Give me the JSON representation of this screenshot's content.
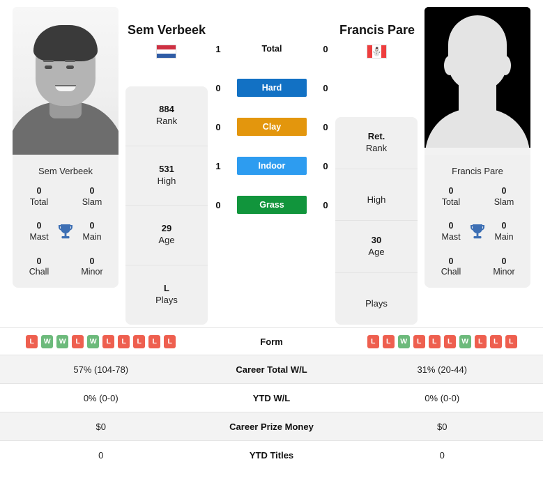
{
  "colors": {
    "hard": "#1271c4",
    "clay": "#e3960d",
    "indoor": "#2d9cf0",
    "grass": "#11953c",
    "win": "#6cba7b",
    "loss": "#ee5f4f",
    "panel": "#f0f0f0",
    "trophy": "#3d6fb4"
  },
  "players": {
    "left": {
      "name": "Sem Verbeek",
      "card_name": "Sem Verbeek",
      "country": "Netherlands",
      "flag_icon": "flag-netherlands-icon",
      "photo_icon": "player-photo",
      "titles": [
        {
          "value": "0",
          "label": "Total"
        },
        {
          "value": "0",
          "label": "Slam"
        },
        {
          "value": "0",
          "label": "Mast"
        },
        {
          "value": "0",
          "label": "Main"
        },
        {
          "value": "0",
          "label": "Chall"
        },
        {
          "value": "0",
          "label": "Minor"
        }
      ],
      "meta": [
        {
          "value": "884",
          "label": "Rank"
        },
        {
          "value": "531",
          "label": "High"
        },
        {
          "value": "29",
          "label": "Age"
        },
        {
          "value": "L",
          "label": "Plays"
        }
      ],
      "form": [
        "L",
        "W",
        "W",
        "L",
        "W",
        "L",
        "L",
        "L",
        "L",
        "L"
      ]
    },
    "right": {
      "name": "Francis Pare",
      "card_name": "Francis Pare",
      "country": "Canada",
      "flag_icon": "flag-canada-icon",
      "photo_icon": "player-silhouette-placeholder",
      "titles": [
        {
          "value": "0",
          "label": "Total"
        },
        {
          "value": "0",
          "label": "Slam"
        },
        {
          "value": "0",
          "label": "Mast"
        },
        {
          "value": "0",
          "label": "Main"
        },
        {
          "value": "0",
          "label": "Chall"
        },
        {
          "value": "0",
          "label": "Minor"
        }
      ],
      "meta": [
        {
          "value": "Ret.",
          "label": "Rank"
        },
        {
          "value": "",
          "label": "High"
        },
        {
          "value": "30",
          "label": "Age"
        },
        {
          "value": "",
          "label": "Plays"
        }
      ],
      "form": [
        "L",
        "L",
        "W",
        "L",
        "L",
        "L",
        "W",
        "L",
        "L",
        "L"
      ]
    }
  },
  "surfaces": [
    {
      "label": "Total",
      "left": "1",
      "right": "0",
      "style": "plain"
    },
    {
      "label": "Hard",
      "left": "0",
      "right": "0",
      "style": "hard"
    },
    {
      "label": "Clay",
      "left": "0",
      "right": "0",
      "style": "clay"
    },
    {
      "label": "Indoor",
      "left": "1",
      "right": "0",
      "style": "indoor"
    },
    {
      "label": "Grass",
      "left": "0",
      "right": "0",
      "style": "grass"
    }
  ],
  "stats_table": {
    "form_label": "Form",
    "rows": [
      {
        "label": "Career Total W/L",
        "left": "57% (104-78)",
        "right": "31% (20-44)"
      },
      {
        "label": "YTD W/L",
        "left": "0% (0-0)",
        "right": "0% (0-0)"
      },
      {
        "label": "Career Prize Money",
        "left": "$0",
        "right": "$0"
      },
      {
        "label": "YTD Titles",
        "left": "0",
        "right": "0"
      }
    ]
  }
}
